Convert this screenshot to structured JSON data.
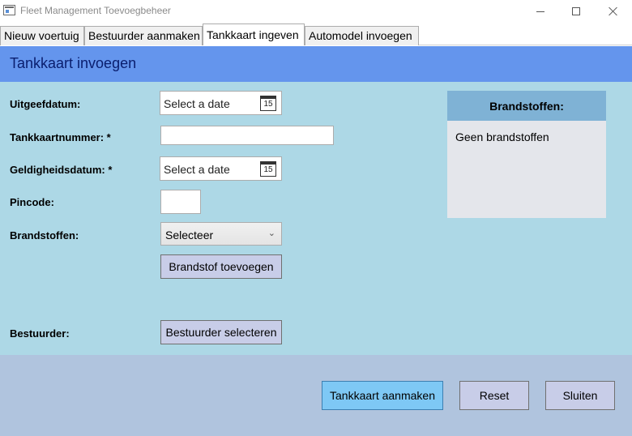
{
  "window": {
    "title": "Fleet Management Toevoegbeheer"
  },
  "tabs": [
    {
      "label": "Nieuw voertuig"
    },
    {
      "label": "Bestuurder aanmaken"
    },
    {
      "label": "Tankkaart ingeven"
    },
    {
      "label": "Automodel invoegen"
    }
  ],
  "header": {
    "title": "Tankkaart invoegen"
  },
  "form": {
    "uitgeefdatum_label": "Uitgeefdatum:",
    "uitgeefdatum_placeholder": "Select a date",
    "tankkaartnummer_label": "Tankkaartnummer: *",
    "tankkaartnummer_value": "",
    "geldigheidsdatum_label": "Geldigheidsdatum: *",
    "geldigheidsdatum_placeholder": "Select a date",
    "pincode_label": "Pincode:",
    "pincode_value": "",
    "brandstoffen_label": "Brandstoffen:",
    "brandstoffen_selected": "Selecteer",
    "add_fuel_button": "Brandstof toevoegen",
    "bestuurder_label": "Bestuurder:",
    "select_driver_button": "Bestuurder selecteren",
    "calendar_day": "15"
  },
  "fuel_panel": {
    "title": "Brandstoffen:",
    "empty_text": "Geen brandstoffen"
  },
  "footer": {
    "create_button": "Tankkaart aanmaken",
    "reset_button": "Reset",
    "close_button": "Sluiten"
  },
  "colors": {
    "header_bg": "#6495ed",
    "form_bg": "#add8e6",
    "footer_bg": "#b0c4de",
    "primary_button": "#7ec8f5"
  }
}
